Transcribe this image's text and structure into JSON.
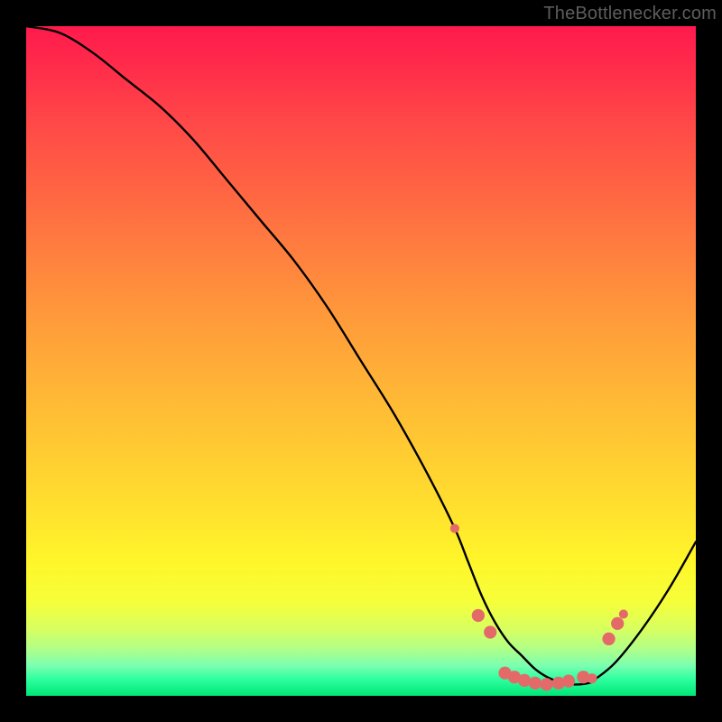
{
  "attribution": "TheBottlenecker.com",
  "chart_data": {
    "type": "line",
    "title": "",
    "xlabel": "",
    "ylabel": "",
    "xlim": [
      0,
      100
    ],
    "ylim": [
      0,
      100
    ],
    "series": [
      {
        "name": "bottleneck-curve",
        "x": [
          0,
          5,
          10,
          15,
          20,
          25,
          30,
          35,
          40,
          45,
          50,
          55,
          60,
          64,
          66,
          68,
          70,
          72,
          74,
          76,
          78,
          80,
          82,
          84,
          85,
          88,
          92,
          96,
          100
        ],
        "y": [
          100,
          99,
          96,
          92,
          88,
          83,
          77,
          71,
          65,
          58,
          50,
          42,
          33,
          25,
          20,
          15,
          11,
          8,
          6,
          4,
          2.7,
          2.0,
          1.7,
          1.9,
          2.5,
          5,
          10,
          16,
          23
        ]
      }
    ],
    "markers": {
      "name": "highlight-points",
      "color": "#e46a6a",
      "points": [
        {
          "x": 64,
          "y": 25,
          "r": 2.2
        },
        {
          "x": 67.5,
          "y": 12,
          "r": 3.1
        },
        {
          "x": 69.3,
          "y": 9.5,
          "r": 3.1
        },
        {
          "x": 71.5,
          "y": 3.4,
          "r": 3.1
        },
        {
          "x": 72.9,
          "y": 2.8,
          "r": 3.1
        },
        {
          "x": 74.4,
          "y": 2.3,
          "r": 3.1
        },
        {
          "x": 76.0,
          "y": 1.9,
          "r": 3.1
        },
        {
          "x": 77.7,
          "y": 1.7,
          "r": 3.1
        },
        {
          "x": 79.5,
          "y": 1.9,
          "r": 3.1
        },
        {
          "x": 81.0,
          "y": 2.2,
          "r": 3.1
        },
        {
          "x": 83.2,
          "y": 2.8,
          "r": 3.1
        },
        {
          "x": 84.5,
          "y": 2.6,
          "r": 2.4
        },
        {
          "x": 87.0,
          "y": 8.5,
          "r": 3.1
        },
        {
          "x": 88.3,
          "y": 10.8,
          "r": 3.1
        },
        {
          "x": 89.2,
          "y": 12.2,
          "r": 2.2
        }
      ]
    },
    "colors": {
      "line": "#000000",
      "marker": "#e46a6a",
      "gradient_top": "#ff1a4d",
      "gradient_bottom": "#00e676"
    }
  }
}
